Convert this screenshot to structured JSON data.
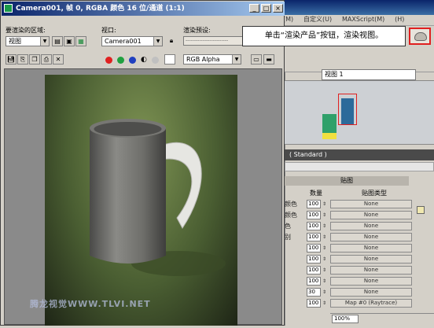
{
  "background_app": {
    "menu": [
      "(M)",
      "自定义(U)",
      "MAXScript(M)",
      "(H)"
    ],
    "viewport_select": "视图 1",
    "standard_label": "( Standard )",
    "maps_title": "贴图",
    "col_amount": "数量",
    "col_map_type": "贴图类型",
    "map_rows": [
      {
        "name": "颜色",
        "amount": "100",
        "map": "None"
      },
      {
        "name": "颜色",
        "amount": "100",
        "map": "None"
      },
      {
        "name": "色",
        "amount": "100",
        "map": "None"
      },
      {
        "name": "别",
        "amount": "100",
        "map": "None"
      },
      {
        "name": "",
        "amount": "100",
        "map": "None"
      },
      {
        "name": "",
        "amount": "100",
        "map": "None"
      },
      {
        "name": "",
        "amount": "100",
        "map": "None"
      },
      {
        "name": "",
        "amount": "100",
        "map": "None"
      },
      {
        "name": "",
        "amount": "30",
        "map": "None"
      },
      {
        "name": "",
        "amount": "100",
        "map": "Map #0  (Raytrace)"
      }
    ],
    "zoom": "100%"
  },
  "window": {
    "title": "Camera001, 帧 0, RGBA 颜色 16 位/通道 (1:1)",
    "area_label": "要渲染的区域:",
    "area_value": "视图",
    "viewport_label": "视口:",
    "viewport_value": "Camera001",
    "preset_label": "渲染预设:",
    "preset_value": "-------------------------",
    "channel_value": "RGB Alpha",
    "colors": {
      "red": "#e02020",
      "green": "#20a040",
      "blue": "#2040c0",
      "swatch": "#ffffff"
    }
  },
  "watermark": "腾龙视觉WWW.TLVI.NET",
  "callout": "单击“渲染产品”按钮，渲染视图。"
}
